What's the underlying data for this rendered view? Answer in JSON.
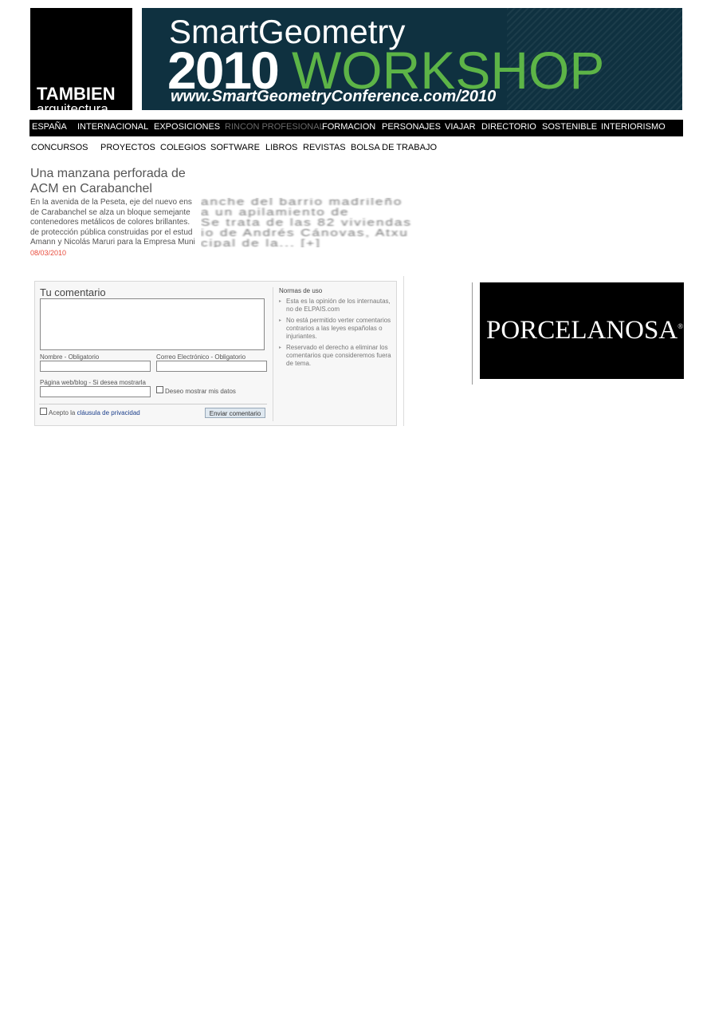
{
  "logo": {
    "line1": "TAMBIEN",
    "line2": "arquitectura"
  },
  "banner": {
    "line1": "SmartGeometry",
    "year": "2010",
    "workshop": "WORKSHOP",
    "url": "www.SmartGeometryConference.com/2010",
    "colors": {
      "background": "#0f3140",
      "accent": "#5db447"
    }
  },
  "nav_primary": [
    "ESPAÑA",
    "INTERNACIONAL",
    "EXPOSICIONES",
    "RINCON PROFESIONAL",
    "FORMACION",
    "PERSONAJES",
    "VIAJAR",
    "DIRECTORIO",
    "SOSTENIBLE",
    "INTERIORISMO"
  ],
  "nav_secondary": [
    "CONCURSOS",
    "PROYECTOS",
    "COLEGIOS",
    "SOFTWARE",
    "LIBROS",
    "REVISTAS",
    "BOLSA DE TRABAJO"
  ],
  "article": {
    "title": "Una manzana perforada de ACM en Carabanchel",
    "body_lines": [
      "En la avenida de la Peseta, eje del nuevo ens",
      "de Carabanchel se alza un bloque semejante",
      "contenedores metálicos de colores brillantes.",
      "de protección pública construidas por el estud",
      "Amann y Nicolás Maruri para la Empresa Muni"
    ],
    "blurred_lines": [
      "anche del barrio madrileño",
      "a un apilamiento de",
      " Se trata de las 82 viviendas",
      "io de Andrés Cánovas, Atxu",
      "cipal de la... [+]"
    ],
    "date": "08/03/2010"
  },
  "comment_form": {
    "title": "Tu comentario",
    "name_label": "Nombre - Obligatorio",
    "email_label": "Correo Electrónico - Obligatorio",
    "web_label": "Página web/blog - Si desea mostrarla",
    "show_data_label": "Deseo mostrar mis datos",
    "accept_prefix": "Acepto la",
    "privacy_link": "cláusula de privacidad",
    "send_button": "Enviar comentario",
    "rules_title": "Normas de uso",
    "rules": [
      "Esta es la opinión de los internautas, no de ELPAIS.com",
      "No está permitido verter comentarios contrarios a las leyes españolas o injuriantes.",
      "Reservado el derecho a eliminar los comentarios que consideremos fuera de tema."
    ]
  },
  "ad": {
    "brand": "PORCELANOSA",
    "reg": "®"
  }
}
